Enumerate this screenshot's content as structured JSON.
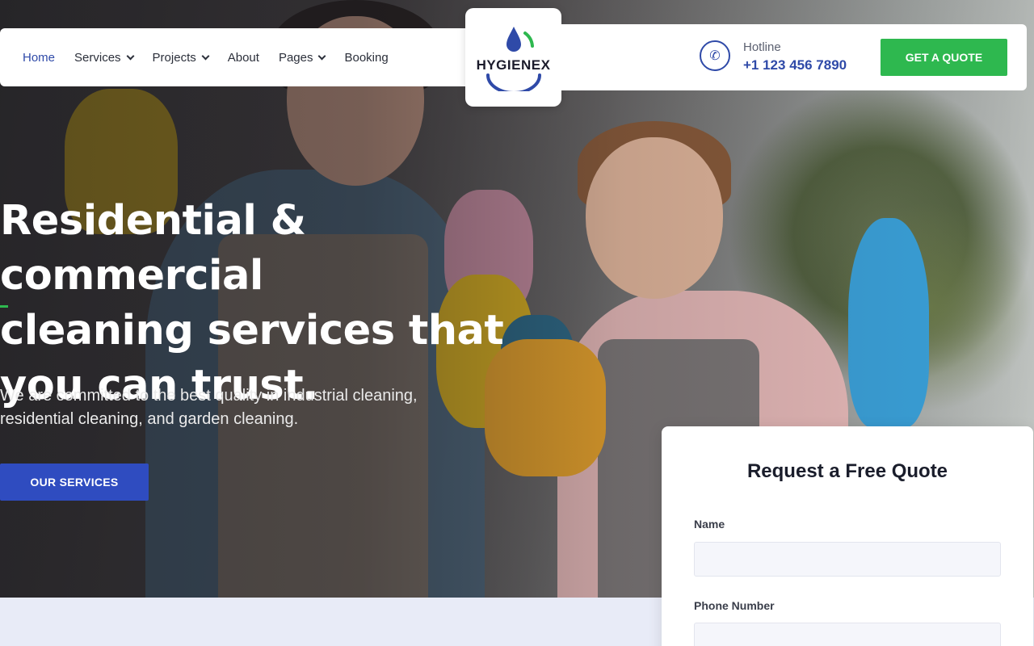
{
  "nav": {
    "items": [
      {
        "label": "Home",
        "active": true,
        "dropdown": false
      },
      {
        "label": "Services",
        "active": false,
        "dropdown": true
      },
      {
        "label": "Projects",
        "active": false,
        "dropdown": true
      },
      {
        "label": "About",
        "active": false,
        "dropdown": false
      },
      {
        "label": "Pages",
        "active": false,
        "dropdown": true
      },
      {
        "label": "Booking",
        "active": false,
        "dropdown": false
      }
    ]
  },
  "logo": {
    "text": "HYGIENEX",
    "icon": "water-drop-icon"
  },
  "header": {
    "hotline_label": "Hotline",
    "hotline_number": "+1 123 456 7890",
    "quote_button": "GET A QUOTE"
  },
  "hero": {
    "headline_line1": "Residential & commercial",
    "headline_line2": "cleaning services that",
    "headline_line3": "you can trust.",
    "subtext_line1": "We are committed to the best quality in industrial cleaning,",
    "subtext_line2": "residential cleaning, and garden cleaning.",
    "button": "OUR SERVICES"
  },
  "form": {
    "title": "Request a Free Quote",
    "name_label": "Name",
    "phone_label": "Phone Number"
  },
  "colors": {
    "brand_blue": "#2f4aa8",
    "brand_green": "#2eb84f",
    "button_blue": "#2f4cc0"
  }
}
